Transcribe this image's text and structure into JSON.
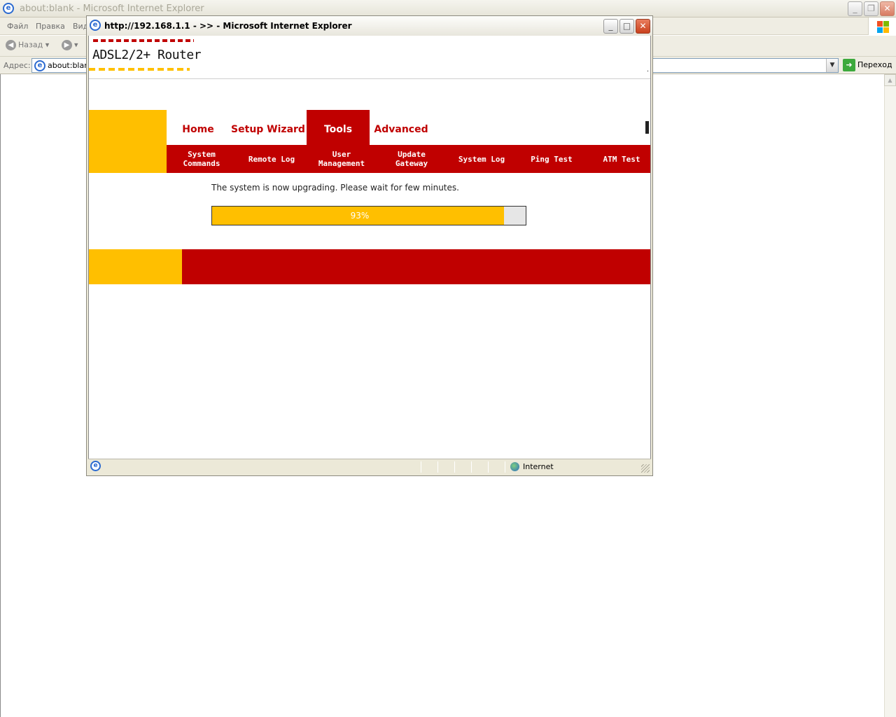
{
  "background_window": {
    "title": "about:blank - Microsoft Internet Explorer",
    "menu": [
      "Файл",
      "Правка",
      "Вид"
    ],
    "back_label": "Назад",
    "address_label": "Адрес:",
    "address_value": "about:blank",
    "go_label": "Переход"
  },
  "popup": {
    "title": "http://192.168.1.1 - >> - Microsoft Internet Explorer",
    "logo_text": "ADSL2/2+ Router",
    "main_tabs": [
      {
        "label": "Home"
      },
      {
        "label": "Setup Wizard"
      },
      {
        "label": "Tools"
      },
      {
        "label": "Advanced"
      }
    ],
    "active_tab": "Tools",
    "sub_tabs": [
      {
        "label": "System\nCommands"
      },
      {
        "label": "Remote Log"
      },
      {
        "label": "User\nManagement"
      },
      {
        "label": "Update\nGateway"
      },
      {
        "label": "System Log"
      },
      {
        "label": "Ping Test"
      },
      {
        "label": "ATM Test"
      }
    ],
    "status_message": "The system is now upgrading. Please wait for few minutes.",
    "progress": {
      "percent": 93,
      "label": "93%"
    },
    "status_zone": "Internet"
  },
  "colors": {
    "brand_red": "#c00000",
    "brand_yellow": "#ffbf00"
  },
  "icons": [
    "ie-page-icon",
    "back-arrow-icon",
    "forward-arrow-icon",
    "go-arrow-icon",
    "windows-flag-icon",
    "globe-icon"
  ]
}
